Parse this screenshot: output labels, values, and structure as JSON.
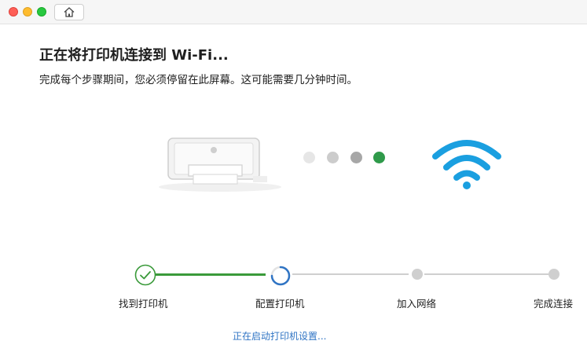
{
  "window": {
    "controls": [
      "close",
      "minimize",
      "zoom"
    ],
    "home_icon": "home-icon"
  },
  "header": {
    "title": "正在将打印机连接到 Wi-Fi...",
    "subtitle": "完成每个步骤期间，您必须停留在此屏幕。这可能需要几分钟时间。"
  },
  "illustration": {
    "printer_icon": "printer-icon",
    "wifi_icon": "wifi-icon",
    "progress_dots": {
      "count": 4,
      "active_index": 3
    },
    "colors": {
      "wifi": "#1a9fe0",
      "active_dot": "#2f9a4a"
    }
  },
  "steps": [
    {
      "label": "找到打印机",
      "state": "complete"
    },
    {
      "label": "配置打印机",
      "state": "in_progress"
    },
    {
      "label": "加入网络",
      "state": "pending"
    },
    {
      "label": "完成连接",
      "state": "pending"
    }
  ],
  "status_text": "正在启动打印机设置...",
  "colors": {
    "complete": "#3a9a3a",
    "pending": "#cfcfcf",
    "link": "#2f74c4"
  }
}
